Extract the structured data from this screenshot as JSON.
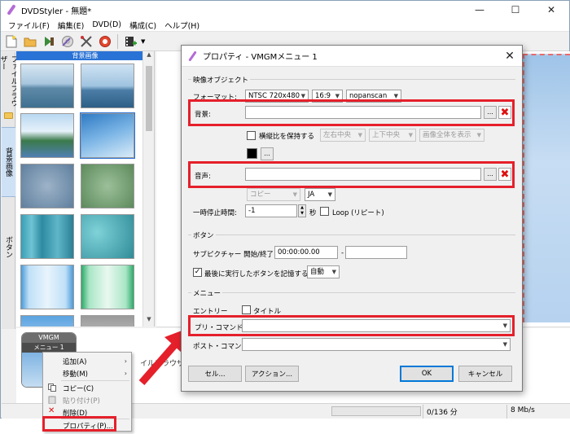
{
  "window": {
    "title": "DVDStyler - 無題*",
    "minimize": "—",
    "maximize": "☐",
    "close": "✕"
  },
  "menubar": [
    {
      "label": "ファイル(F)"
    },
    {
      "label": "編集(E)"
    },
    {
      "label": "DVD(D)"
    },
    {
      "label": "構成(C)"
    },
    {
      "label": "ヘルプ(H)"
    }
  ],
  "side_tabs": {
    "file_browser": "ファイルブラウザー",
    "backgrounds": "背景画像",
    "buttons": "ボタン"
  },
  "thumb_panel": {
    "header": "背景画像"
  },
  "menu_node": {
    "top": "VMGM",
    "name": "メニュー 1"
  },
  "behind_text": "イルブラウザから",
  "status": {
    "size": "0/136 分",
    "rate": "8 Mb/s"
  },
  "context_menu": {
    "items": [
      {
        "label": "追加(A)"
      },
      {
        "label": "移動(M)"
      },
      {
        "label": "コピー(C)"
      },
      {
        "label": "貼り付け(P)"
      },
      {
        "label": "削除(D)"
      },
      {
        "label": "プロパティ(P)..."
      }
    ]
  },
  "dialog": {
    "title": "プロパティ - VMGMメニュー 1",
    "close": "✕",
    "video_group": "映像オブジェクト",
    "format_label": "フォーマット:",
    "format_value": "NTSC 720x480",
    "aspect_value": "16:9",
    "pan_value": "nopanscan",
    "background_label": "背景:",
    "background_value": "",
    "browse": "...",
    "keep_aspect_label": "横縦比を保持する",
    "h_align": "左右中央",
    "v_align": "上下中央",
    "fit_mode": "画像全体を表示",
    "audio_label": "音声:",
    "audio_value": "",
    "audio_mode": "コピー",
    "audio_lang": "JA",
    "pause_label": "一時停止時間:",
    "pause_value": "-1",
    "pause_unit": "秒",
    "loop_label": "Loop (リピート)",
    "buttons_group": "ボタン",
    "subpicture_label": "サブピクチャー 開始/終了:",
    "start_value": "00:00:00.00",
    "dash": "-",
    "end_value": "",
    "remember_label": "最後に実行したボタンを記憶する",
    "remember_value": "自動",
    "menu_group": "メニュー",
    "entry_label": "エントリー",
    "title_check_label": "タイトル",
    "pre_command_label": "プリ・コマンド:",
    "pre_command_value": "",
    "post_command_label": "ポスト・コマンド:",
    "post_command_value": "",
    "cell_button": "セル...",
    "action_button": "アクション...",
    "ok_button": "OK",
    "cancel_button": "キャンセル"
  }
}
